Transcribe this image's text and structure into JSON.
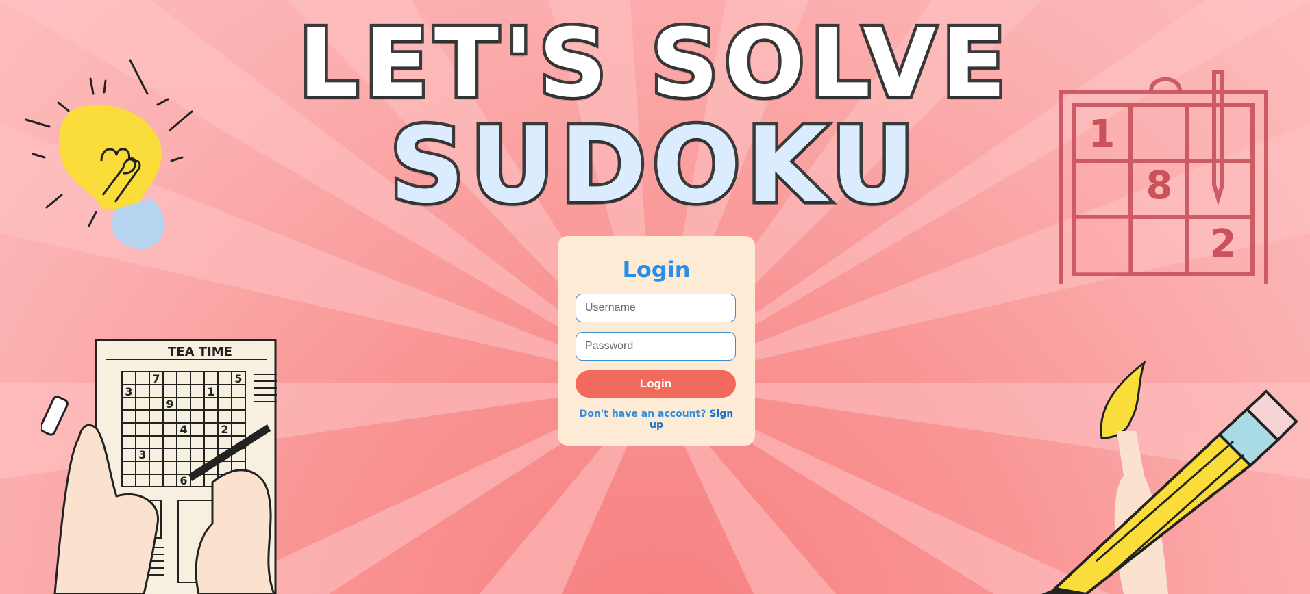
{
  "app": {
    "title_line1": "LET'S SOLVE",
    "title_line2": "SUDOKU"
  },
  "login_card": {
    "heading": "Login",
    "username_placeholder": "Username",
    "password_placeholder": "Password",
    "username_value": "",
    "password_value": "",
    "submit_label": "Login",
    "signup_prompt": "Don't have an account?",
    "signup_link": "Sign up"
  },
  "illustrations": {
    "newspaper_heading": "TEA TIME",
    "newspaper_numbers": [
      "7",
      "5",
      "3",
      "1",
      "9",
      "4",
      "2",
      "3",
      "6"
    ],
    "notepad_numbers": [
      "1",
      "8",
      "2"
    ]
  },
  "colors": {
    "background": "#fcb0b0",
    "card": "#fdebd6",
    "accent_blue": "#2a8ee6",
    "button": "#f26a5c"
  },
  "icons": [
    "light-bulb-icon",
    "sudoku-notepad-icon",
    "newspaper-sudoku-icon",
    "pencil-icon"
  ]
}
